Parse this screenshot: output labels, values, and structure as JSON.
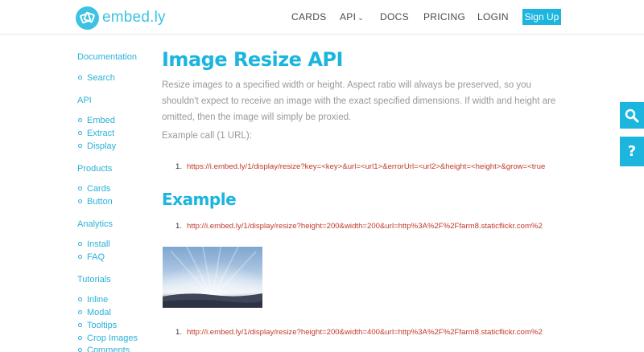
{
  "header": {
    "logo_text": "embed.ly",
    "nav": {
      "cards": "CARDS",
      "api": "API",
      "docs": "DOCS",
      "pricing": "PRICING",
      "login": "LOGIN",
      "signup": "Sign Up"
    }
  },
  "sidebar": {
    "documentation": "Documentation",
    "search": "Search",
    "api": "API",
    "embed": "Embed",
    "extract": "Extract",
    "display": "Display",
    "products": "Products",
    "cards": "Cards",
    "button": "Button",
    "analytics": "Analytics",
    "install": "Install",
    "faq": "FAQ",
    "tutorials": "Tutorials",
    "inline": "Inline",
    "modal": "Modal",
    "tooltips": "Tooltips",
    "crop_images": "Crop Images",
    "comments": "Comments"
  },
  "main": {
    "title": "Image Resize API",
    "intro": "Resize images to a specified width or height. Aspect ratio will always be preserved, so you shouldn't expect to receive an image with the exact specified dimensions. If width and height are omitted, then the image will simply be proxied.",
    "example_call_label": "Example call (1 URL):",
    "example_call_num": "1.",
    "example_call_url": "https://i.embed.ly/1/display/resize?key=<key>&url=<url1>&errorUrl=<url2>&height=<height>&grow=<true",
    "example_title": "Example",
    "example1_num": "1.",
    "example1_url": "http://i.embed.ly/1/display/resize?height=200&width=200&url=http%3A%2F%2Ffarm8.staticflickr.com%2",
    "example2_num": "1.",
    "example2_url": "http://i.embed.ly/1/display/resize?height=200&width=400&url=http%3A%2F%2Ffarm8.staticflickr.com%2"
  },
  "side_tabs": {
    "search_icon": "search-icon",
    "help_icon": "question-icon"
  },
  "colors": {
    "accent": "#1bb5dd",
    "link": "#2ab1d8",
    "code": "#c0392b"
  }
}
